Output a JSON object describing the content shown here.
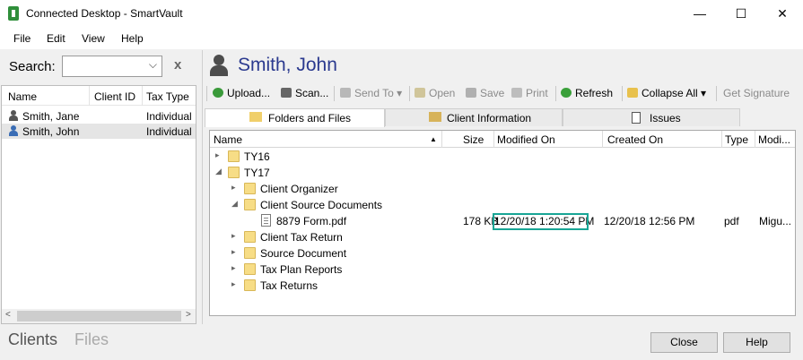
{
  "window": {
    "title": "Connected Desktop - SmartVault",
    "minimize": "—",
    "maximize": "☐",
    "close": "✕"
  },
  "menu": [
    "File",
    "Edit",
    "View",
    "Help"
  ],
  "search": {
    "label": "Search:",
    "value": "",
    "clear": "x"
  },
  "client_list": {
    "columns": [
      "Name",
      "Client ID",
      "Tax Type"
    ],
    "rows": [
      {
        "name": "Smith, Jane",
        "client_id": "",
        "tax_type": "Individual",
        "selected": false
      },
      {
        "name": "Smith, John",
        "client_id": "",
        "tax_type": "Individual",
        "selected": true
      }
    ]
  },
  "bottom_tabs": {
    "clients": "Clients",
    "files": "Files"
  },
  "client_header": {
    "name": "Smith, John"
  },
  "toolbar": {
    "upload": "Upload...",
    "scan": "Scan...",
    "send_to": "Send To",
    "open": "Open",
    "save": "Save",
    "print": "Print",
    "refresh": "Refresh",
    "collapse_all": "Collapse All",
    "get_signature": "Get Signature"
  },
  "tabs": [
    "Folders and Files",
    "Client Information",
    "Issues"
  ],
  "files": {
    "columns": [
      "Name",
      "Size",
      "Modified On",
      "Created On",
      "Type",
      "Modi..."
    ],
    "rows": [
      {
        "name": "TY16",
        "size": "",
        "modified": "",
        "created": "",
        "type": "",
        "modified_by": ""
      },
      {
        "name": "TY17",
        "size": "",
        "modified": "",
        "created": "",
        "type": "",
        "modified_by": ""
      },
      {
        "name": "Client Organizer",
        "size": "",
        "modified": "",
        "created": "",
        "type": "",
        "modified_by": ""
      },
      {
        "name": "Client Source Documents",
        "size": "",
        "modified": "",
        "created": "",
        "type": "",
        "modified_by": ""
      },
      {
        "name": "8879 Form.pdf",
        "size": "178 KB",
        "modified": "12/20/18 1:20:54 PM",
        "created": "12/20/18 12:56 PM",
        "type": "pdf",
        "modified_by": "Migu..."
      },
      {
        "name": "Client Tax Return",
        "size": "",
        "modified": "",
        "created": "",
        "type": "",
        "modified_by": ""
      },
      {
        "name": "Source Document",
        "size": "",
        "modified": "",
        "created": "",
        "type": "",
        "modified_by": ""
      },
      {
        "name": "Tax Plan Reports",
        "size": "",
        "modified": "",
        "created": "",
        "type": "",
        "modified_by": ""
      },
      {
        "name": "Tax Returns",
        "size": "",
        "modified": "",
        "created": "",
        "type": "",
        "modified_by": ""
      }
    ]
  },
  "buttons": {
    "close": "Close",
    "help": "Help"
  },
  "colors": {
    "title_blue": "#2b3a8f",
    "highlight": "#18a595",
    "folder": "#f7dd86"
  }
}
